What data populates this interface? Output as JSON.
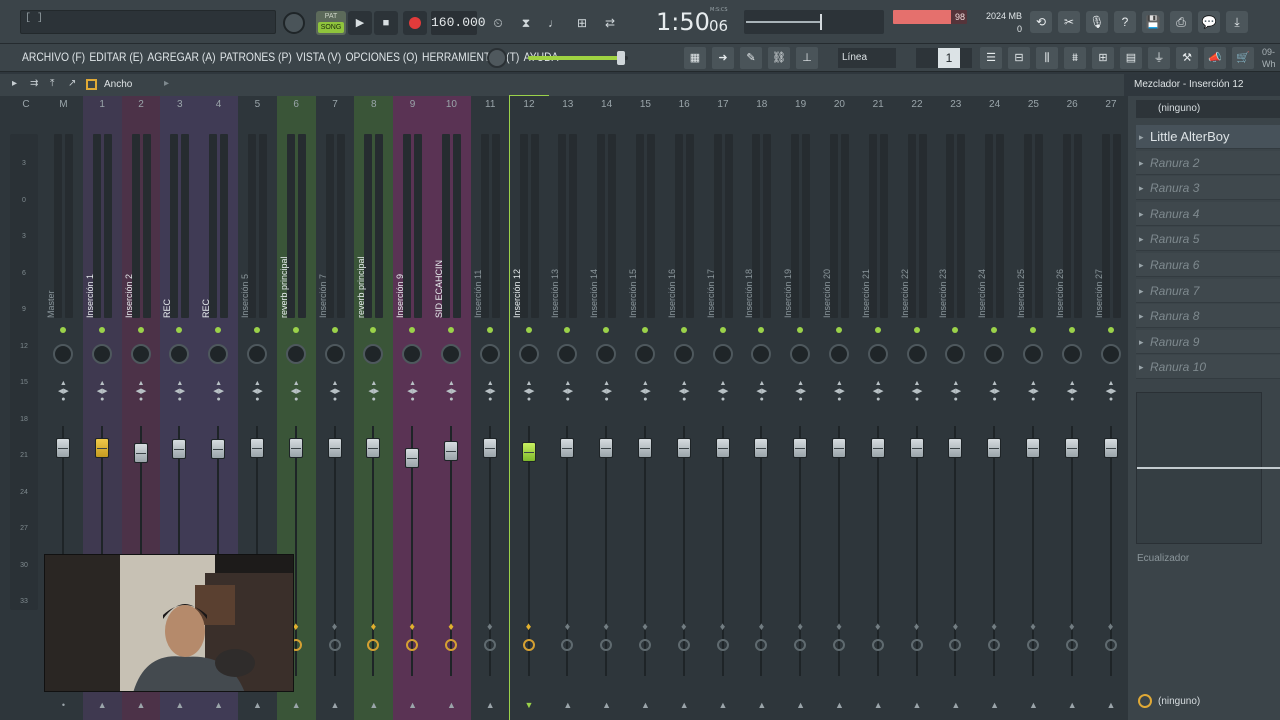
{
  "topbar": {
    "hint": "[ ]",
    "mode_pat": "PAT",
    "mode_song": "SONG",
    "tempo": "160.000",
    "time_main": "1:50",
    "time_sub": "06",
    "time_label": "M:S:CS",
    "cpu_value": 98,
    "cpu_fill_pct": 78,
    "memory": "2024 MB",
    "poly": "0"
  },
  "menu": {
    "items": [
      "ARCHIVO (F)",
      "EDITAR (E)",
      "AGREGAR (A)",
      "PATRONES (P)",
      "VISTA (V)",
      "OPCIONES (O)",
      "HERRAMIENTAS (T)",
      "AYUDA"
    ],
    "snap": "Línea",
    "pattern_number": "1",
    "master_volume_pct": 93,
    "corner": "09- Wh"
  },
  "mixer": {
    "width_label": "Ancho",
    "title": "Mezclador - Inserción 12",
    "scale": [
      "3",
      "0",
      "3",
      "6",
      "9",
      "12",
      "15",
      "18",
      "21",
      "24",
      "27",
      "30",
      "33"
    ],
    "tracks": [
      {
        "num": "C",
        "name": "",
        "bg": "#2e363b",
        "fader_pos": 0.4,
        "fx": false,
        "route": ""
      },
      {
        "num": "M",
        "name": "Master",
        "bg": "#2e363b",
        "fader_pos": 0.4,
        "fx": false,
        "route": "•"
      },
      {
        "num": "1",
        "name": "Inserción 1",
        "bg": "#3f3950",
        "fader_pos": 0.4,
        "fx": false,
        "route": "▲"
      },
      {
        "num": "2",
        "name": "Inserción 2",
        "bg": "#4c3248",
        "fader_pos": 0.55,
        "fx": false,
        "route": "▲"
      },
      {
        "num": "3",
        "name": "REC",
        "bg": "#403b55",
        "fader_pos": 0.42,
        "fx": false,
        "route": "▲"
      },
      {
        "num": "4",
        "name": "REC",
        "bg": "#403b55",
        "fader_pos": 0.42,
        "fx": false,
        "route": "▲"
      },
      {
        "num": "5",
        "name": "Inserción 5",
        "bg": "#2e363b",
        "fader_pos": 0.4,
        "fx": false,
        "route": "▲"
      },
      {
        "num": "6",
        "name": "reverb principal",
        "bg": "#3a5538",
        "fader_pos": 0.4,
        "fx": true,
        "route": "▲"
      },
      {
        "num": "7",
        "name": "Inserción 7",
        "bg": "#2e363b",
        "fader_pos": 0.4,
        "fx": false,
        "route": "▲"
      },
      {
        "num": "8",
        "name": "reverb principal",
        "bg": "#3a5538",
        "fader_pos": 0.4,
        "fx": true,
        "route": "▲"
      },
      {
        "num": "9",
        "name": "Inserción 9",
        "bg": "#5a3354",
        "fader_pos": 0.72,
        "fx": true,
        "route": "▲"
      },
      {
        "num": "10",
        "name": "SID ECAHCIN",
        "bg": "#5a3354",
        "fader_pos": 0.5,
        "fx": true,
        "route": "▲"
      },
      {
        "num": "11",
        "name": "Inserción 11",
        "bg": "#2e363b",
        "fader_pos": 0.4,
        "fx": false,
        "route": "▲"
      },
      {
        "num": "12",
        "name": "Inserción 12",
        "bg": "#2e363b",
        "fader_pos": 0.52,
        "fx": true,
        "route": "▼"
      },
      {
        "num": "13",
        "name": "Inserción 13",
        "bg": "#2e363b",
        "fader_pos": 0.4,
        "fx": false,
        "route": "▲"
      },
      {
        "num": "14",
        "name": "Inserción 14",
        "bg": "#2e363b",
        "fader_pos": 0.4,
        "fx": false,
        "route": "▲"
      },
      {
        "num": "15",
        "name": "Inserción 15",
        "bg": "#2e363b",
        "fader_pos": 0.4,
        "fx": false,
        "route": "▲"
      },
      {
        "num": "16",
        "name": "Inserción 16",
        "bg": "#2e363b",
        "fader_pos": 0.4,
        "fx": false,
        "route": "▲"
      },
      {
        "num": "17",
        "name": "Inserción 17",
        "bg": "#2e363b",
        "fader_pos": 0.4,
        "fx": false,
        "route": "▲"
      },
      {
        "num": "18",
        "name": "Inserción 18",
        "bg": "#2e363b",
        "fader_pos": 0.4,
        "fx": false,
        "route": "▲"
      },
      {
        "num": "19",
        "name": "Inserción 19",
        "bg": "#2e363b",
        "fader_pos": 0.4,
        "fx": false,
        "route": "▲"
      },
      {
        "num": "20",
        "name": "Inserción 20",
        "bg": "#2e363b",
        "fader_pos": 0.4,
        "fx": false,
        "route": "▲"
      },
      {
        "num": "21",
        "name": "Inserción 21",
        "bg": "#2e363b",
        "fader_pos": 0.4,
        "fx": false,
        "route": "▲"
      },
      {
        "num": "22",
        "name": "Inserción 22",
        "bg": "#2e363b",
        "fader_pos": 0.4,
        "fx": false,
        "route": "▲"
      },
      {
        "num": "23",
        "name": "Inserción 23",
        "bg": "#2e363b",
        "fader_pos": 0.4,
        "fx": false,
        "route": "▲"
      },
      {
        "num": "24",
        "name": "Inserción 24",
        "bg": "#2e363b",
        "fader_pos": 0.4,
        "fx": false,
        "route": "▲"
      },
      {
        "num": "25",
        "name": "Inserción 25",
        "bg": "#2e363b",
        "fader_pos": 0.4,
        "fx": false,
        "route": "▲"
      },
      {
        "num": "26",
        "name": "Inserción 26",
        "bg": "#2e363b",
        "fader_pos": 0.4,
        "fx": false,
        "route": "▲"
      },
      {
        "num": "27",
        "name": "Inserción 27",
        "bg": "#2e363b",
        "fader_pos": 0.4,
        "fx": false,
        "route": "▲"
      }
    ]
  },
  "panel": {
    "route_top": "(ninguno)",
    "slots": [
      "Little AlterBoy",
      "Ranura 2",
      "Ranura 3",
      "Ranura 4",
      "Ranura 5",
      "Ranura 6",
      "Ranura 7",
      "Ranura 8",
      "Ranura 9",
      "Ranura 10"
    ],
    "eq_label": "Ecualizador",
    "route_bottom": "(ninguno)"
  }
}
